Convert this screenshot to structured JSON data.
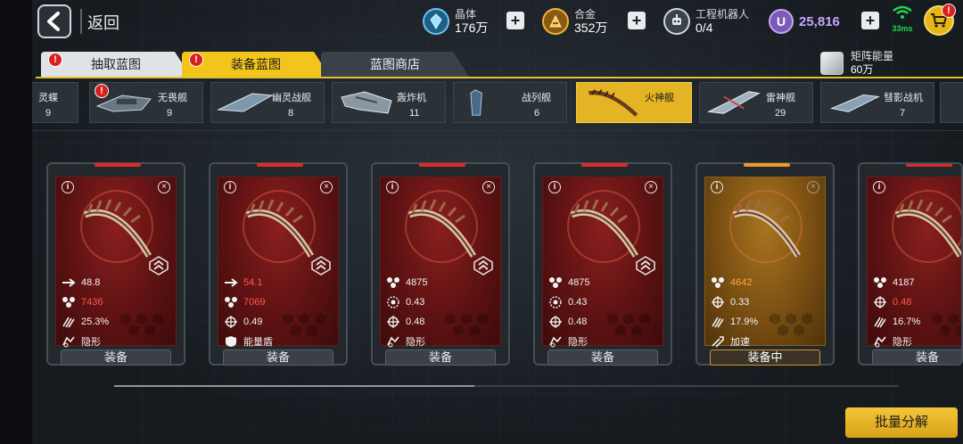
{
  "header": {
    "back_label": "返回",
    "resources": [
      {
        "label": "晶体",
        "value": "176万",
        "icon": "crystal-icon"
      },
      {
        "label": "合金",
        "value": "352万",
        "icon": "alloy-icon"
      },
      {
        "label": "工程机器人",
        "value": "0/4",
        "icon": "robot-icon"
      }
    ],
    "premium_currency": {
      "symbol": "U",
      "value": "25,816"
    },
    "ping": "33ms",
    "cart_badge": "!"
  },
  "tabs": [
    {
      "label": "抽取蓝图",
      "badge": "!"
    },
    {
      "label": "装备蓝图",
      "badge": "!",
      "active": true
    },
    {
      "label": "蓝图商店"
    }
  ],
  "matrix_energy": {
    "label": "矩阵能量",
    "value": "60万"
  },
  "ships": [
    {
      "name": "灵蝶",
      "count": "9"
    },
    {
      "name": "无畏舰",
      "count": "9",
      "badge": "!"
    },
    {
      "name": "幽灵战舰",
      "count": "8"
    },
    {
      "name": "轰炸机",
      "count": "11"
    },
    {
      "name": "战列舰",
      "count": "6"
    },
    {
      "name": "火神舰",
      "count": "",
      "active": true
    },
    {
      "name": "雷神舰",
      "count": "29"
    },
    {
      "name": "彗影战机",
      "count": "7"
    }
  ],
  "cards": [
    {
      "stats": [
        {
          "icon": "speed-arrow-icon",
          "value": "48.8"
        },
        {
          "icon": "hp-cluster-icon",
          "value": "7436",
          "highlight": true
        },
        {
          "icon": "claw-icon",
          "value": "25.3%"
        },
        {
          "icon": "stealth-icon",
          "value": "隐形"
        }
      ],
      "button": "装备"
    },
    {
      "stats": [
        {
          "icon": "speed-arrow-icon",
          "value": "54.1",
          "highlight": true
        },
        {
          "icon": "hp-cluster-icon",
          "value": "7069",
          "highlight": true
        },
        {
          "icon": "crosshair-icon",
          "value": "0.49"
        },
        {
          "icon": "energy-shield-icon",
          "value": "能量盾"
        }
      ],
      "button": "装备"
    },
    {
      "stats": [
        {
          "icon": "hp-cluster-icon",
          "value": "4875"
        },
        {
          "icon": "reticle-icon",
          "value": "0.43"
        },
        {
          "icon": "crosshair-icon",
          "value": "0.48"
        },
        {
          "icon": "stealth-icon",
          "value": "隐形"
        }
      ],
      "button": "装备"
    },
    {
      "stats": [
        {
          "icon": "hp-cluster-icon",
          "value": "4875"
        },
        {
          "icon": "reticle-icon",
          "value": "0.43"
        },
        {
          "icon": "crosshair-icon",
          "value": "0.48"
        },
        {
          "icon": "stealth-icon",
          "value": "隐形"
        }
      ],
      "button": "装备"
    },
    {
      "stats": [
        {
          "icon": "hp-cluster-icon",
          "value": "4642",
          "highlight": true
        },
        {
          "icon": "crosshair-icon",
          "value": "0.33"
        },
        {
          "icon": "claw-icon",
          "value": "17.9%"
        },
        {
          "icon": "boost-icon",
          "value": "加速"
        }
      ],
      "button": "装备中",
      "equipped": true
    },
    {
      "stats": [
        {
          "icon": "hp-cluster-icon",
          "value": "4187"
        },
        {
          "icon": "crosshair-icon",
          "value": "0.48",
          "highlight": true
        },
        {
          "icon": "claw-icon",
          "value": "16.7%"
        },
        {
          "icon": "stealth-icon",
          "value": "隐形"
        }
      ],
      "button": "装备"
    }
  ],
  "bulk_button": "批量分解",
  "colors": {
    "accent": "#f3c41c",
    "highlight_red": "#ff5a4e",
    "highlight_orange": "#ffa640",
    "card_red": "#5e1212",
    "card_gold": "#7a4f12"
  }
}
